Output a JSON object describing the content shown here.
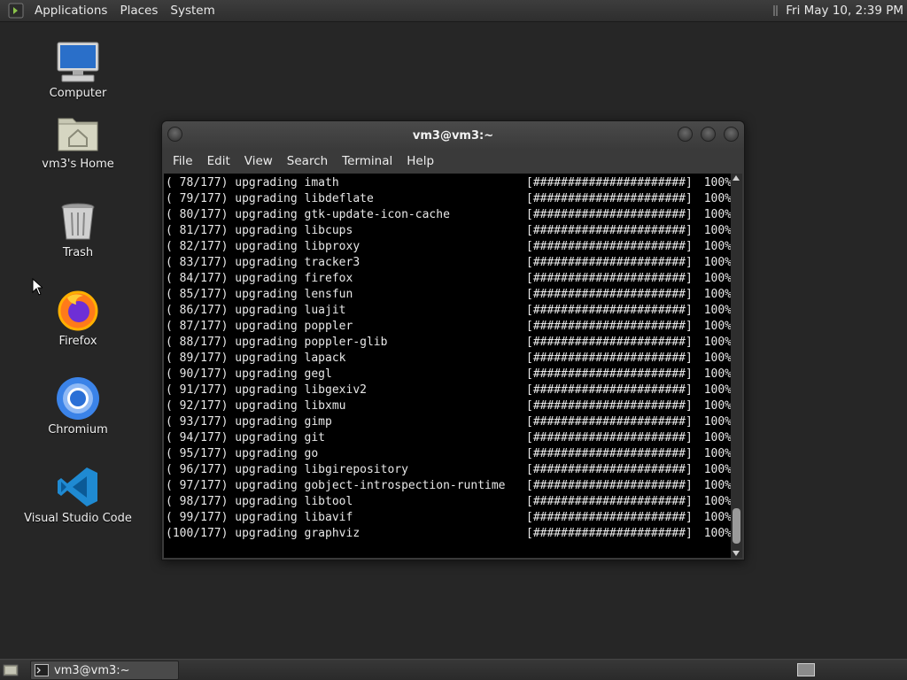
{
  "top_panel": {
    "menus": [
      "Applications",
      "Places",
      "System"
    ],
    "clock": "Fri May 10,  2:39 PM"
  },
  "desktop": {
    "icons": [
      {
        "label": "Computer",
        "icon": "computer-icon"
      },
      {
        "label": "vm3's Home",
        "icon": "home-folder-icon"
      },
      {
        "label": "Trash",
        "icon": "trash-icon"
      },
      {
        "label": "Firefox",
        "icon": "firefox-icon"
      },
      {
        "label": "Chromium",
        "icon": "chromium-icon"
      },
      {
        "label": "Visual Studio Code",
        "icon": "vscode-icon"
      }
    ]
  },
  "terminal": {
    "title": "vm3@vm3:~",
    "menu": [
      "File",
      "Edit",
      "View",
      "Search",
      "Terminal",
      "Help"
    ],
    "lines": [
      {
        "text": "( 78/177) upgrading imath",
        "bar": "[######################]",
        "pct": "100%"
      },
      {
        "text": "( 79/177) upgrading libdeflate",
        "bar": "[######################]",
        "pct": "100%"
      },
      {
        "text": "( 80/177) upgrading gtk-update-icon-cache",
        "bar": "[######################]",
        "pct": "100%"
      },
      {
        "text": "( 81/177) upgrading libcups",
        "bar": "[######################]",
        "pct": "100%"
      },
      {
        "text": "( 82/177) upgrading libproxy",
        "bar": "[######################]",
        "pct": "100%"
      },
      {
        "text": "( 83/177) upgrading tracker3",
        "bar": "[######################]",
        "pct": "100%"
      },
      {
        "text": "( 84/177) upgrading firefox",
        "bar": "[######################]",
        "pct": "100%"
      },
      {
        "text": "( 85/177) upgrading lensfun",
        "bar": "[######################]",
        "pct": "100%"
      },
      {
        "text": "( 86/177) upgrading luajit",
        "bar": "[######################]",
        "pct": "100%"
      },
      {
        "text": "( 87/177) upgrading poppler",
        "bar": "[######################]",
        "pct": "100%"
      },
      {
        "text": "( 88/177) upgrading poppler-glib",
        "bar": "[######################]",
        "pct": "100%"
      },
      {
        "text": "( 89/177) upgrading lapack",
        "bar": "[######################]",
        "pct": "100%"
      },
      {
        "text": "( 90/177) upgrading gegl",
        "bar": "[######################]",
        "pct": "100%"
      },
      {
        "text": "( 91/177) upgrading libgexiv2",
        "bar": "[######################]",
        "pct": "100%"
      },
      {
        "text": "( 92/177) upgrading libxmu",
        "bar": "[######################]",
        "pct": "100%"
      },
      {
        "text": "( 93/177) upgrading gimp",
        "bar": "[######################]",
        "pct": "100%"
      },
      {
        "text": "( 94/177) upgrading git",
        "bar": "[######################]",
        "pct": "100%"
      },
      {
        "text": "( 95/177) upgrading go",
        "bar": "[######################]",
        "pct": "100%"
      },
      {
        "text": "( 96/177) upgrading libgirepository",
        "bar": "[######################]",
        "pct": "100%"
      },
      {
        "text": "( 97/177) upgrading gobject-introspection-runtime",
        "bar": "[######################]",
        "pct": "100%"
      },
      {
        "text": "( 98/177) upgrading libtool",
        "bar": "[######################]",
        "pct": "100%"
      },
      {
        "text": "( 99/177) upgrading libavif",
        "bar": "[######################]",
        "pct": "100%"
      },
      {
        "text": "(100/177) upgrading graphviz",
        "bar": "[######################]",
        "pct": "100%"
      }
    ]
  },
  "taskbar": {
    "task_label": "vm3@vm3:~"
  }
}
